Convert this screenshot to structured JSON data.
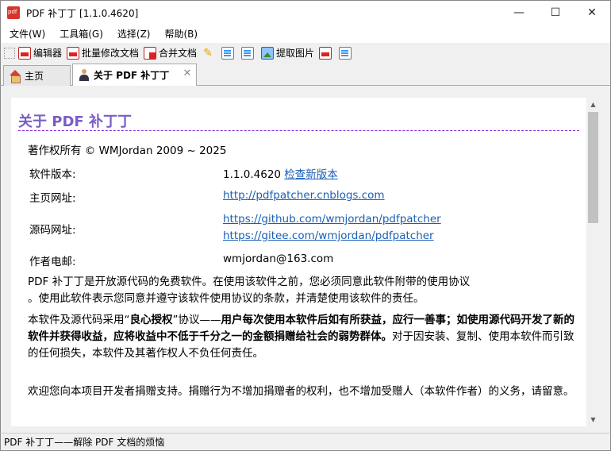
{
  "window": {
    "title": "PDF 补丁丁 [1.1.0.4620]",
    "minimize": "—",
    "maximize": "☐",
    "close": "✕"
  },
  "menu": [
    "文件(W)",
    "工具箱(G)",
    "选择(Z)",
    "帮助(B)"
  ],
  "toolbar": {
    "editor": "编辑器",
    "batch_modify": "批量修改文档",
    "merge": "合并文档",
    "extract_images": "提取图片"
  },
  "tabs": {
    "home": "主页",
    "about": "关于 PDF 补丁丁",
    "close_glyph": "✕"
  },
  "about": {
    "heading": "关于 PDF 补丁丁",
    "copyright": "著作权所有 © WMJordan 2009 ~ 2025",
    "version_label": "软件版本:",
    "version_value": "1.1.0.4620",
    "check_update": "检查新版本",
    "homepage_label": "主页网址:",
    "homepage_url": "http://pdfpatcher.cnblogs.com",
    "source_label": "源码网址:",
    "source_url_1": "https://github.com/wmjordan/pdfpatcher",
    "source_url_2": "https://gitee.com/wmjordan/pdfpatcher",
    "email_label": "作者电邮:",
    "email_value": "wmjordan@163.com",
    "para1_line1": "PDF 补丁丁是开放源代码的免费软件。在使用该软件之前，您必须同意此软件附带的使用协议",
    "para1_line2": "。使用此软件表示您同意并遵守该软件使用协议的条款，并清楚使用该软件的责任。",
    "para2_a": "本软件及源代码采用“",
    "para2_b": "良心授权",
    "para2_c": "”协议——",
    "para2_d": "用户每次使用本软件后如有所获益，应行一善事；如使用源代码开发了新的软件并获得收益，应将收益中不低于千分之一的金额捐赠给社会的弱势群体。",
    "para2_e": "对于因安装、复制、使用本软件而引致的任何损失，本软件及其著作权人不负任何责任。",
    "para3": "欢迎您向本项目开发者捐赠支持。捐赠行为不增加捐赠者的权利，也不增加受赠人（本软件作者）的义务，请留意。"
  },
  "status": "PDF 补丁丁——解除 PDF 文档的烦恼",
  "colors": {
    "heading": "#7a5dc7",
    "link": "#1a5fb4",
    "divider": "#8a2be2"
  }
}
